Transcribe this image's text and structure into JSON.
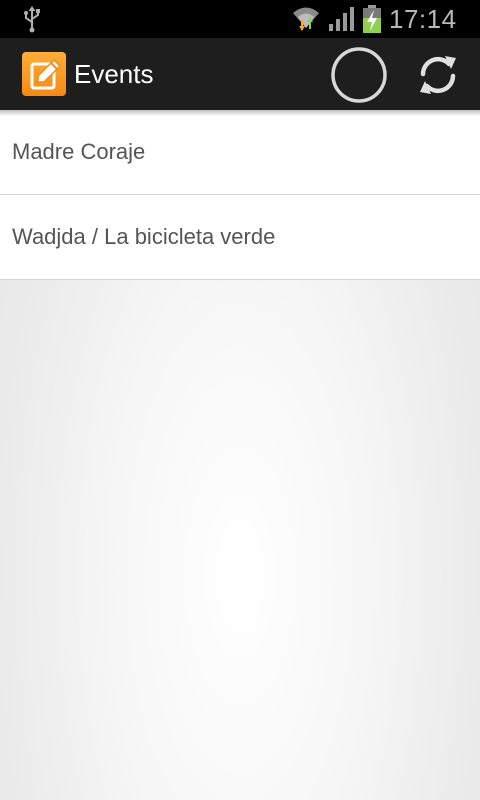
{
  "status_bar": {
    "time": "17:14",
    "icons": [
      "usb-icon",
      "wifi-icon",
      "signal-icon",
      "battery-charging-icon"
    ]
  },
  "action_bar": {
    "title": "Events",
    "app_icon": "pencil-icon",
    "progress_icon": "progress-spinner-icon",
    "refresh_icon": "refresh-icon",
    "accent_color": "#f58a14"
  },
  "events": [
    {
      "label": "Madre Coraje"
    },
    {
      "label": "Wadjda / La bicicleta verde"
    }
  ]
}
